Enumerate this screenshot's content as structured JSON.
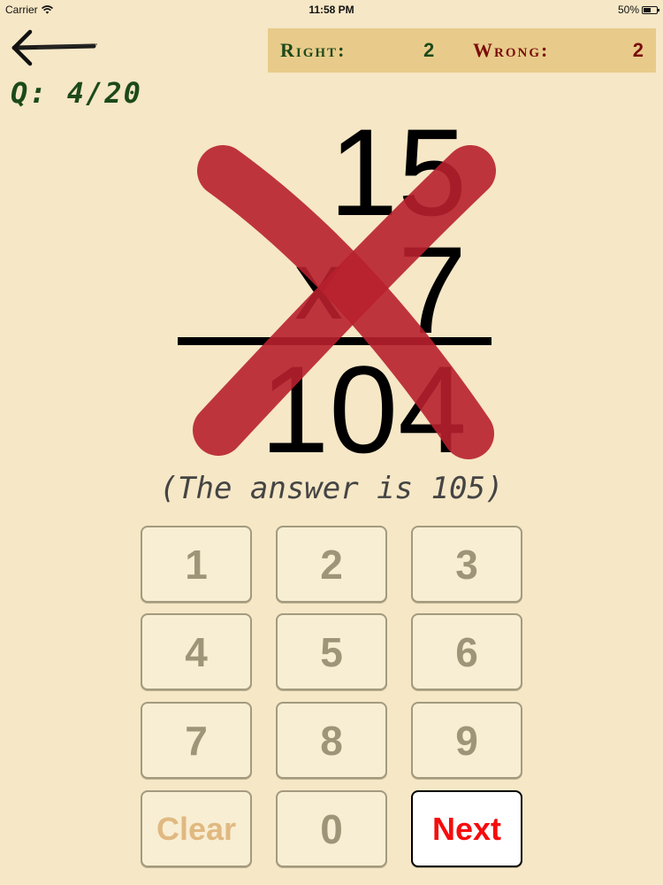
{
  "status_bar": {
    "carrier": "Carrier",
    "time": "11:58 PM",
    "battery": "50%",
    "battery_level": 0.5
  },
  "nav": {
    "back_icon": "arrow-left-icon",
    "question_counter": "Q: 4/20"
  },
  "score": {
    "right_label": "Right:",
    "right_value": "2",
    "wrong_label": "Wrong:",
    "wrong_value": "2",
    "right_color": "#1c4a1a",
    "wrong_color": "#7a0d0d"
  },
  "problem": {
    "top_operand": "15",
    "operator": "x",
    "bottom_operand": "7",
    "user_answer": "104",
    "result_icon": "wrong-cross-icon",
    "cross_color": "#b8202e"
  },
  "hint": "(The answer is 105)",
  "keypad": {
    "keys": [
      "1",
      "2",
      "3",
      "4",
      "5",
      "6",
      "7",
      "8",
      "9"
    ],
    "clear_label": "Clear",
    "zero_label": "0",
    "next_label": "Next"
  }
}
